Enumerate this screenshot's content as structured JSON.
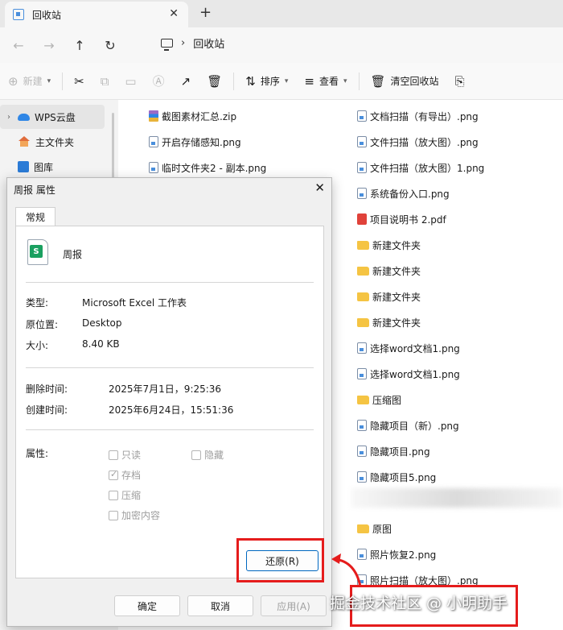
{
  "window": {
    "tab_title": "回收站",
    "tab_close": "✕",
    "new_tab": "+"
  },
  "address": {
    "back": "←",
    "forward": "→",
    "up": "↑",
    "refresh": "↻",
    "separator": "›",
    "location": "回收站"
  },
  "toolbar": {
    "new_label": "新建",
    "sort_label": "排序",
    "view_label": "查看",
    "empty_bin_label": "清空回收站"
  },
  "sidebar": {
    "items": [
      {
        "label": "WPS云盘"
      },
      {
        "label": "主文件夹"
      },
      {
        "label": "图库"
      }
    ]
  },
  "files": {
    "left": [
      {
        "name": "截图素材汇总.zip",
        "type": "zip"
      },
      {
        "name": "开启存储感知.png",
        "type": "png"
      },
      {
        "name": "临时文件夹2 - 副本.png",
        "type": "png"
      }
    ],
    "right": [
      {
        "name": "文档扫描（有导出）.png",
        "type": "png"
      },
      {
        "name": "文件扫描（放大图）.png",
        "type": "png"
      },
      {
        "name": "文件扫描（放大图）1.png",
        "type": "png"
      },
      {
        "name": "系统备份入口.png",
        "type": "png"
      },
      {
        "name": "项目说明书 2.pdf",
        "type": "pdf"
      },
      {
        "name": "新建文件夹",
        "type": "folder"
      },
      {
        "name": "新建文件夹",
        "type": "folder"
      },
      {
        "name": "新建文件夹",
        "type": "folder"
      },
      {
        "name": "新建文件夹",
        "type": "folder"
      },
      {
        "name": "选择word文档1.png",
        "type": "png"
      },
      {
        "name": "选择word文档1.png",
        "type": "png"
      },
      {
        "name": "压缩图",
        "type": "folder"
      },
      {
        "name": "隐藏项目（新）.png",
        "type": "png"
      },
      {
        "name": "隐藏项目.png",
        "type": "png"
      },
      {
        "name": "隐藏项目5.png",
        "type": "png"
      },
      {
        "name": "原图",
        "type": "folder"
      },
      {
        "name": "照片恢复2.png",
        "type": "png"
      },
      {
        "name": "照片扫描（放大图）.png",
        "type": "png"
      }
    ]
  },
  "dialog": {
    "title": "周报 属性",
    "close": "✕",
    "tab_general": "常规",
    "file_name": "周报",
    "icon_letter": "S",
    "type_label": "类型:",
    "type_value": "Microsoft Excel 工作表",
    "location_label": "原位置:",
    "location_value": "Desktop",
    "size_label": "大小:",
    "size_value": "8.40 KB",
    "deleted_label": "删除时间:",
    "deleted_value": "2025年7月1日，9:25:36",
    "created_label": "创建时间:",
    "created_value": "2025年6月24日，15:51:36",
    "attrs_label": "属性:",
    "attr_readonly": "只读",
    "attr_hidden": "隐藏",
    "attr_archive": "存档",
    "attr_compress": "压缩",
    "attr_encrypt": "加密内容",
    "restore_button": "还原(R)",
    "ok_button": "确定",
    "cancel_button": "取消",
    "apply_button": "应用(A)"
  },
  "annotation": {
    "watermark": "掘金技术社区 @ 小明助手",
    "highlight_color": "#e51c1c"
  }
}
